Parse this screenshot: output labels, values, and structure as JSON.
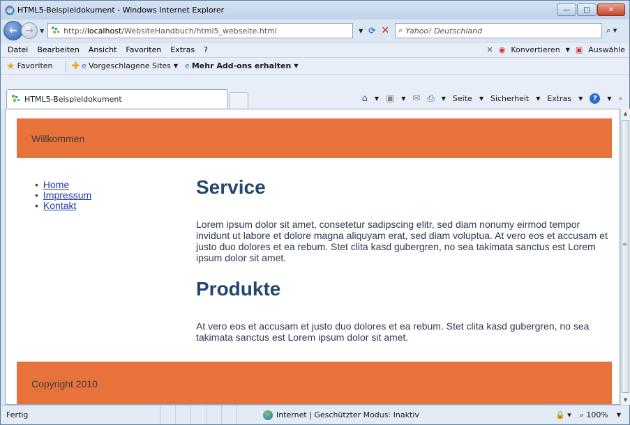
{
  "window": {
    "title": "HTML5-Beispieldokument - Windows Internet Explorer",
    "controls": {
      "minimize": "—",
      "maximize": "□",
      "close": "✕"
    }
  },
  "address": {
    "url_prefix": "http://",
    "url_host": "localhost",
    "url_path": "/WebsiteHandbuch/html5_webseite.html",
    "search_placeholder": "Yahoo! Deutschland"
  },
  "menu": {
    "items": [
      "Datei",
      "Bearbeiten",
      "Ansicht",
      "Favoriten",
      "Extras",
      "?"
    ],
    "convert": "Konvertieren",
    "select": "Auswähle"
  },
  "favorites": {
    "label": "Favoriten",
    "suggested": "Vorgeschlagene Sites",
    "addons": "Mehr Add-ons erhalten"
  },
  "tab": {
    "title": "HTML5-Beispieldokument"
  },
  "command": {
    "page": "Seite",
    "security": "Sicherheit",
    "tools": "Extras"
  },
  "page": {
    "header": "Willkommen",
    "nav": [
      "Home",
      "Impressum",
      "Kontakt"
    ],
    "section1_title": "Service",
    "section1_text": "Lorem ipsum dolor sit amet, consetetur sadipscing elitr, sed diam nonumy eirmod tempor invidunt ut labore et dolore magna aliquyam erat, sed diam voluptua. At vero eos et accusam et justo duo dolores et ea rebum. Stet clita kasd gubergren, no sea takimata sanctus est Lorem ipsum dolor sit amet.",
    "section2_title": "Produkte",
    "section2_text": "At vero eos et accusam et justo duo dolores et ea rebum. Stet clita kasd gubergren, no sea takimata sanctus est Lorem ipsum dolor sit amet.",
    "footer": "Copyright 2010"
  },
  "status": {
    "ready": "Fertig",
    "zone": "Internet | Geschützter Modus: Inaktiv",
    "zoom": "100%"
  },
  "colors": {
    "accent": "#e8723b",
    "heading": "#23466e",
    "link": "#1f3aa8"
  }
}
